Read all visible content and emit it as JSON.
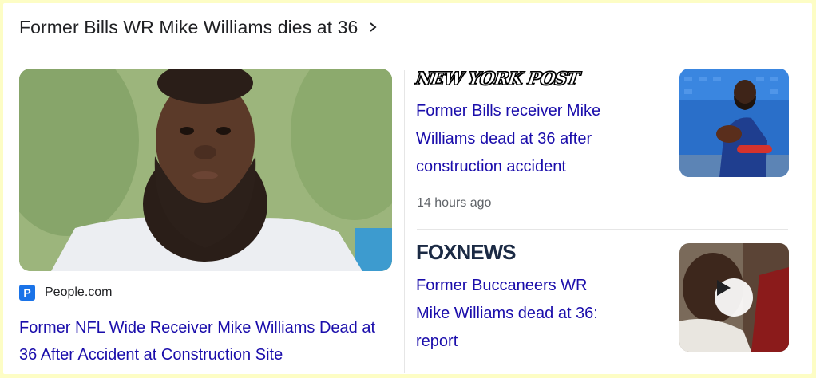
{
  "header": {
    "title": "Former Bills WR Mike Williams dies at 36",
    "chevron_icon": "chevron-right-icon"
  },
  "featured": {
    "source_icon_letter": "P",
    "source_icon_color": "#1a73e8",
    "source": "People.com",
    "title": "Former NFL Wide Receiver Mike Williams Dead at 36 After Accident at Construction Site"
  },
  "stories": [
    {
      "source": "NEW YORK POST",
      "title_lines": [
        "Former Bills receiver Mike",
        "Williams dead at 36 after",
        "construction accident"
      ],
      "time": "14 hours ago"
    },
    {
      "source": "FOXNEWS",
      "title_lines": [
        "Former Buccaneers WR",
        "Mike Williams dead at 36:",
        "report"
      ],
      "play_icon": "play-icon"
    }
  ],
  "colors": {
    "link": "#1a0dab",
    "text": "#202124",
    "meta": "#5f6368",
    "frame": "#fdfdc5"
  }
}
